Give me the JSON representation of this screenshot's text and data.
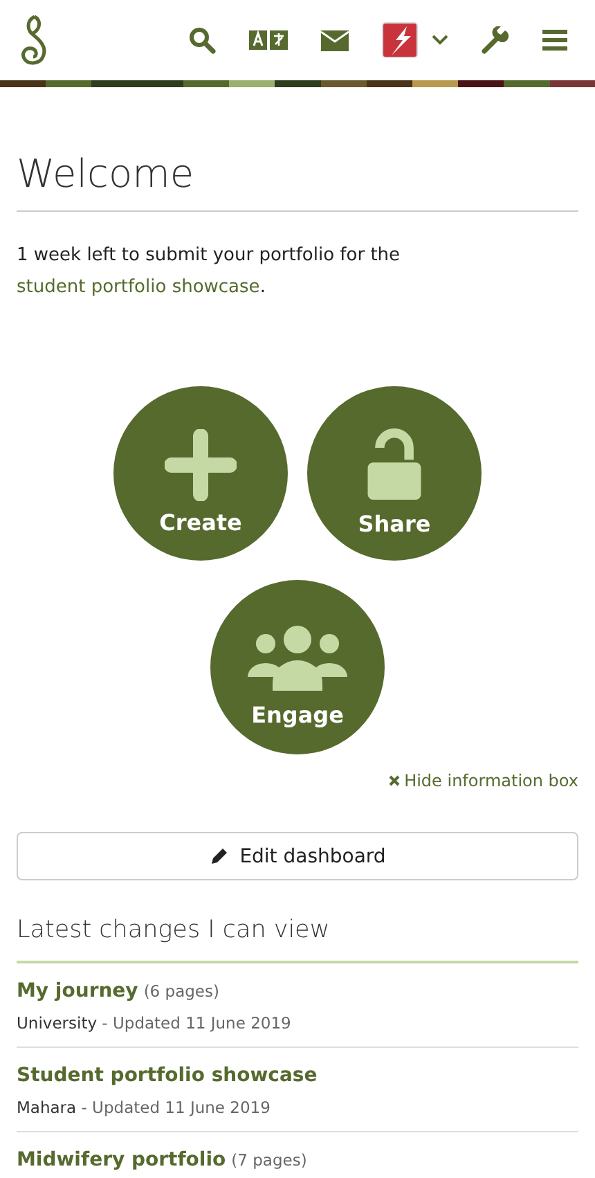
{
  "page_title": "Welcome",
  "notice": {
    "before": "1 week left to submit your portfolio for the ",
    "link": "student portfolio showcase",
    "after": "."
  },
  "actions": [
    {
      "kind": "create",
      "label": "Create"
    },
    {
      "kind": "share",
      "label": "Share"
    },
    {
      "kind": "engage",
      "label": "Engage"
    }
  ],
  "hide_info": "Hide information box",
  "edit_button": "Edit dashboard",
  "latest": {
    "title": "Latest changes I can view",
    "items": [
      {
        "title": "My journey",
        "count": "(6 pages)",
        "owner": "University",
        "updated": " - Updated 11 June 2019"
      },
      {
        "title": "Student portfolio showcase",
        "owner": "Mahara",
        "updated": " - Updated 11 June 2019"
      },
      {
        "title": "Midwifery portfolio",
        "count": "(7 pages)"
      }
    ]
  }
}
